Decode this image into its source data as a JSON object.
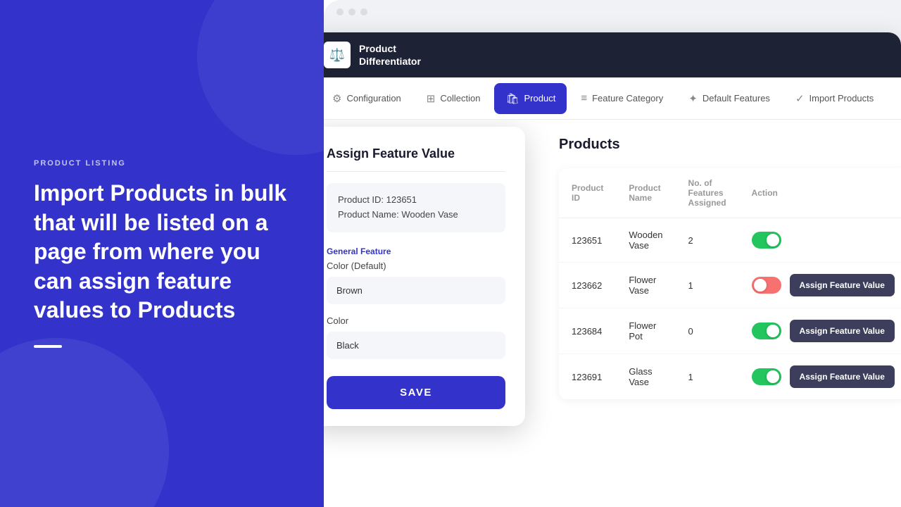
{
  "left": {
    "tag": "PRODUCT LISTING",
    "title": "Import Products in bulk that will be listed on a page from where you can assign feature values to Products",
    "divider": true
  },
  "nav": {
    "logo_text_line1": "Product",
    "logo_text_line2": "Differentiator",
    "logo_icon": "⚖",
    "items": [
      {
        "id": "configuration",
        "label": "Configuration",
        "icon": "⚙",
        "active": false
      },
      {
        "id": "collection",
        "label": "Collection",
        "icon": "⊞",
        "active": false
      },
      {
        "id": "product",
        "label": "Product",
        "icon": "🛍",
        "active": true
      },
      {
        "id": "feature-category",
        "label": "Feature Category",
        "icon": "≡",
        "active": false
      },
      {
        "id": "default-features",
        "label": "Default Features",
        "icon": "✦",
        "active": false
      },
      {
        "id": "import-products",
        "label": "Import Products",
        "icon": "✓",
        "active": false
      }
    ]
  },
  "modal": {
    "title": "Assign Feature Value",
    "product_id_label": "Product ID: 123651",
    "product_name_label": "Product Name: Wooden Vase",
    "general_feature_label": "General Feature",
    "color_default_label": "Color (Default)",
    "color_default_value": "Brown",
    "color_label": "Color",
    "color_value": "Black",
    "save_label": "SAVE"
  },
  "products": {
    "title": "Products",
    "columns": [
      {
        "id": "product-id",
        "label": "Product ID"
      },
      {
        "id": "product-name",
        "label": "Product Name"
      },
      {
        "id": "features-count",
        "label": "No. of Features Assigned"
      },
      {
        "id": "action",
        "label": "Action"
      }
    ],
    "rows": [
      {
        "id": "123651",
        "name": "Wooden Vase",
        "features": "2",
        "toggle": "on",
        "show_assign": false
      },
      {
        "id": "123662",
        "name": "Flower Vase",
        "features": "1",
        "toggle": "off",
        "show_assign": true
      },
      {
        "id": "123684",
        "name": "Flower Pot",
        "features": "0",
        "toggle": "on",
        "show_assign": true
      },
      {
        "id": "123691",
        "name": "Glass Vase",
        "features": "1",
        "toggle": "on",
        "show_assign": true
      }
    ],
    "assign_btn_label": "Assign Feature Value"
  }
}
